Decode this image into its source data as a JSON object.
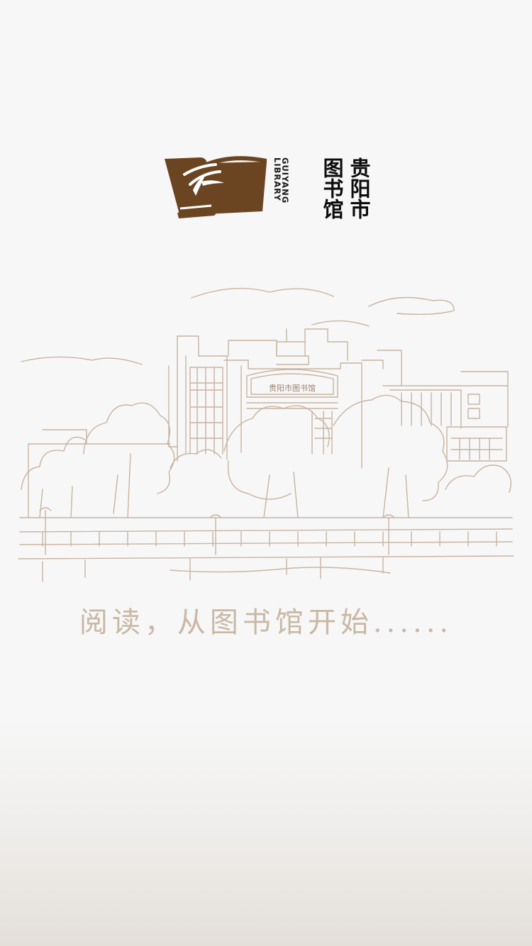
{
  "app": {
    "logo": {
      "name_cn": "贵阳市图书馆",
      "name_en": "GUIYANG\nLIBRARY"
    },
    "illustration": {
      "sign_text": "贵阳市图书馆"
    },
    "slogan": "阅读，从图书馆开始......"
  },
  "colors": {
    "background": "#f7f7f7",
    "brand_brown": "#6b4522",
    "sketch_line": "#c9b4a0",
    "slogan_text": "#c9b8a6"
  },
  "icons": {
    "logo_mark": "open-book-with-bamboo-icon"
  }
}
